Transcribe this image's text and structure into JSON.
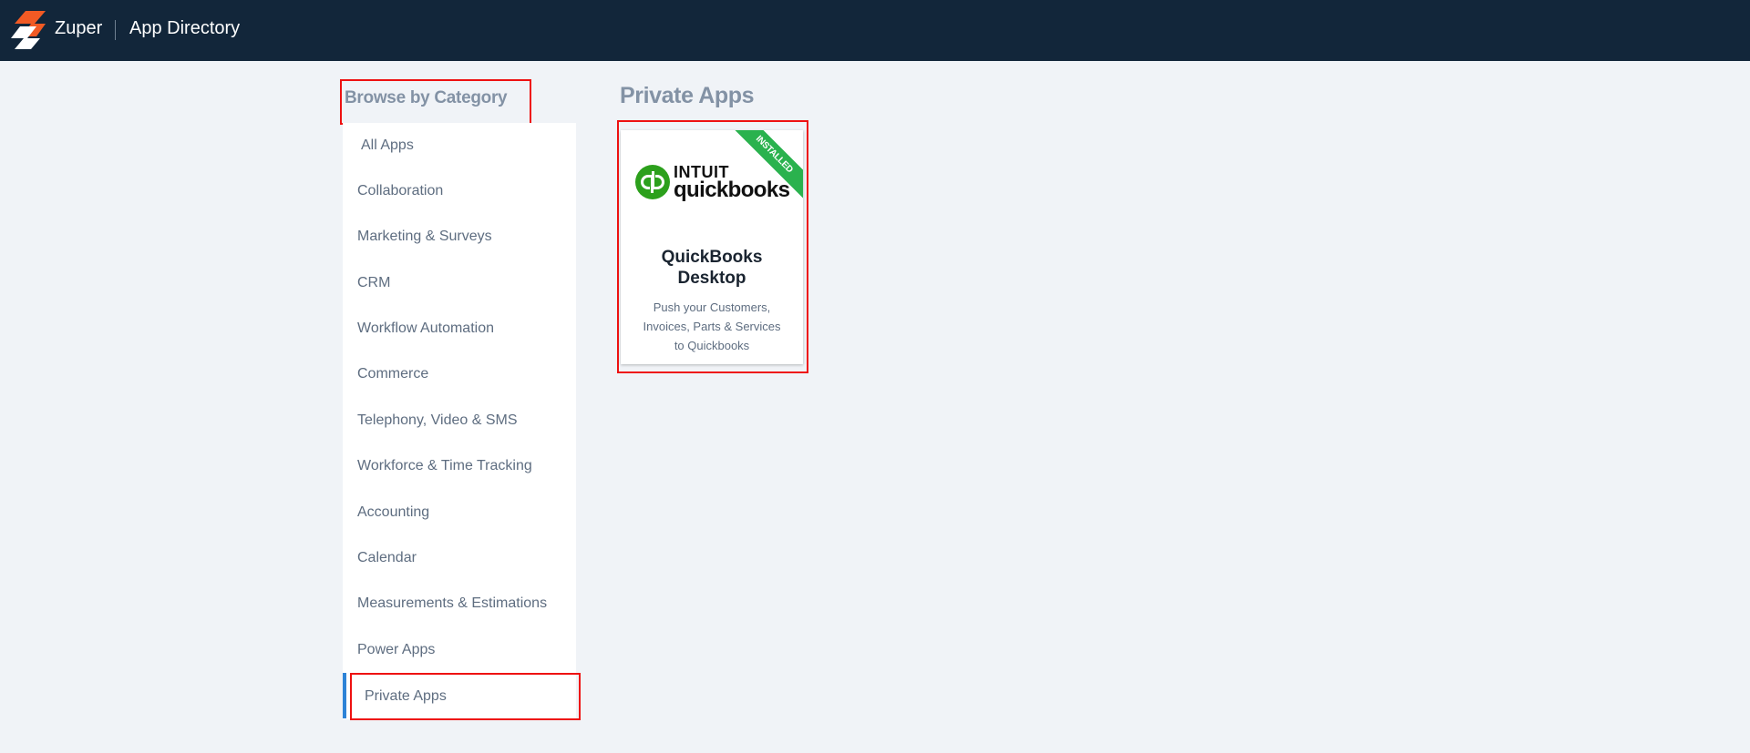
{
  "header": {
    "brand": "Zuper",
    "title": "App Directory"
  },
  "sidebar": {
    "heading": "Browse by Category",
    "items": [
      {
        "label": "All Apps"
      },
      {
        "label": "Collaboration"
      },
      {
        "label": "Marketing & Surveys"
      },
      {
        "label": "CRM"
      },
      {
        "label": "Workflow Automation"
      },
      {
        "label": "Commerce"
      },
      {
        "label": "Telephony, Video & SMS"
      },
      {
        "label": "Workforce & Time Tracking"
      },
      {
        "label": "Accounting"
      },
      {
        "label": "Calendar"
      },
      {
        "label": "Measurements & Estimations"
      },
      {
        "label": "Power Apps"
      },
      {
        "label": "Private Apps",
        "active": true
      }
    ]
  },
  "main": {
    "section_title": "Private Apps",
    "apps": [
      {
        "badge": "INSTALLED",
        "logo_top": "INTUIT",
        "logo_word": "quickbooks",
        "name": "QuickBooks Desktop",
        "description": "Push your Customers, Invoices, Parts & Services to Quickbooks"
      }
    ]
  },
  "colors": {
    "topbar": "#12263a",
    "accent_active": "#2d83d7",
    "installed_badge": "#2ab24e",
    "quickbooks_green": "#2ca01c",
    "highlight": "#ee1111"
  }
}
